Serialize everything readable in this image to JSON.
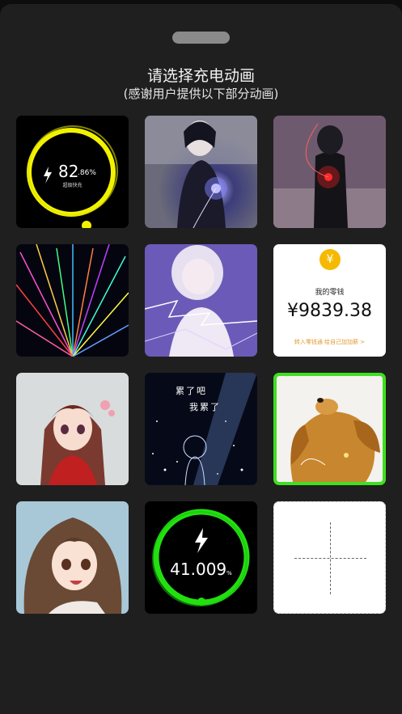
{
  "header": {
    "title": "请选择充电动画",
    "subtitle": "(感谢用户提供以下部分动画)"
  },
  "tiles": [
    {
      "name": "yellow-ring-animation",
      "percent": "82",
      "decimal": ".86",
      "unit": "%",
      "caption": "超级快充"
    },
    {
      "name": "anime-boy-light-animation"
    },
    {
      "name": "anime-boy-red-glow-animation"
    },
    {
      "name": "fireworks-animation"
    },
    {
      "name": "anime-girl-lightning-animation"
    },
    {
      "name": "wallet-balance-animation",
      "coin": "¥",
      "label": "我的零钱",
      "amount": "¥9839.38",
      "link": "转入零钱通 给自己加加薪 >"
    },
    {
      "name": "anime-girl-flowers-animation"
    },
    {
      "name": "starry-boy-animation",
      "line1": "累了吧",
      "line2": "我累了"
    },
    {
      "name": "puppy-animation",
      "selected": true
    },
    {
      "name": "anime-girl-smiling-animation"
    },
    {
      "name": "green-ring-animation",
      "percent": "41.009",
      "unit": "%"
    },
    {
      "name": "add-custom-animation"
    }
  ],
  "colors": {
    "sheet": "#1f1f1f",
    "selected_border": "#3ee01f",
    "yellow_ring": "#f2f200",
    "green_ring": "#22e010",
    "coin": "#f5b900"
  }
}
